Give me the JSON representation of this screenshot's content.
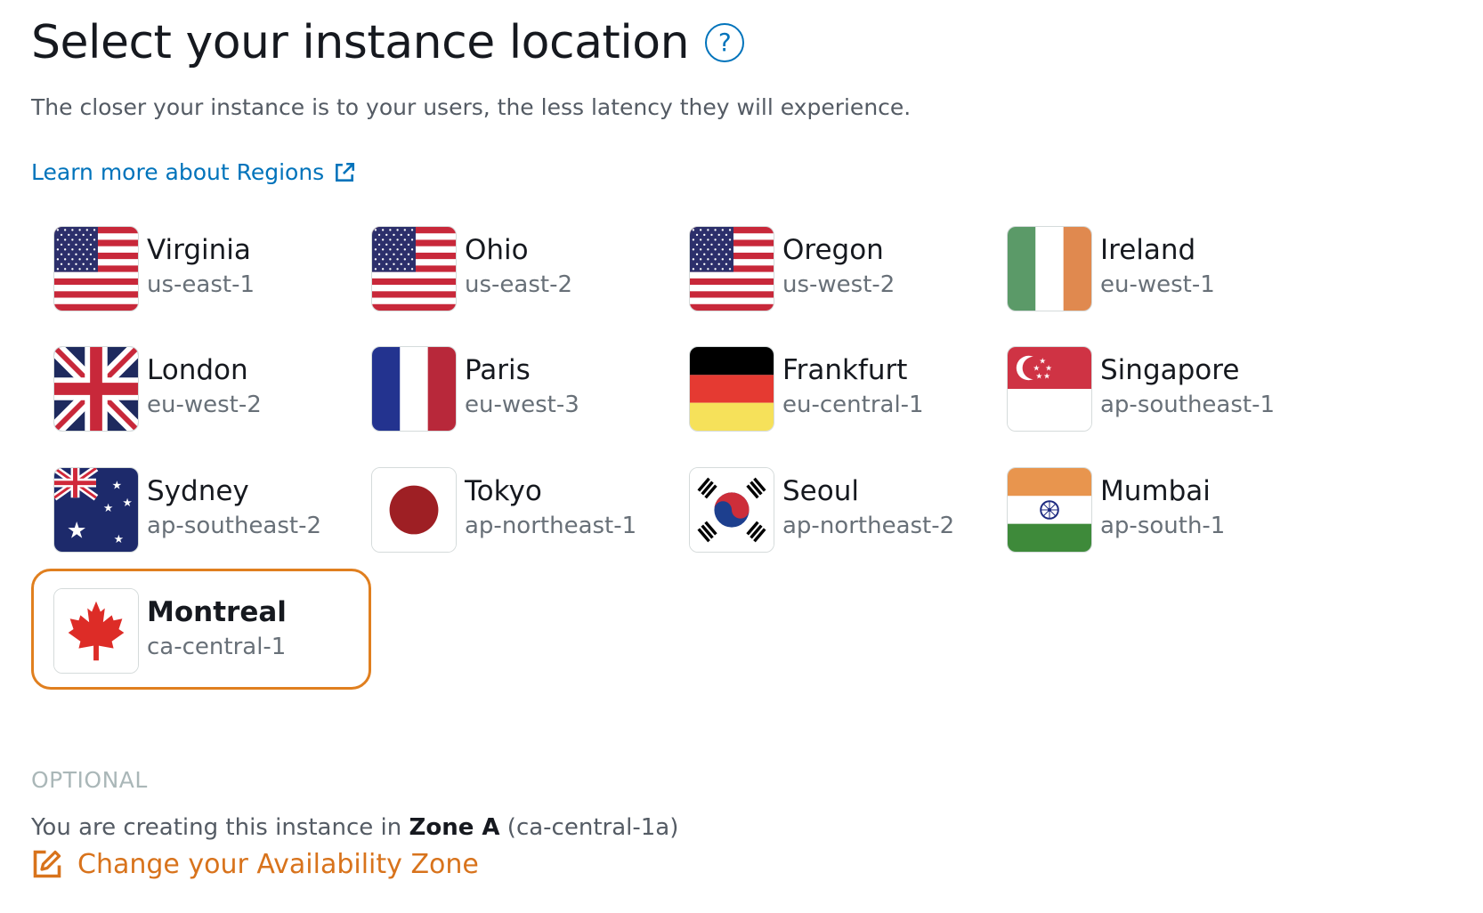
{
  "header": {
    "title": "Select your instance location",
    "help_icon": "question-circle-icon",
    "subtitle": "The closer your instance is to your users, the less latency they will experience.",
    "learn_more": "Learn more about Regions",
    "learn_more_icon": "external-link-icon"
  },
  "regions": [
    {
      "name": "Virginia",
      "code": "us-east-1",
      "flag": "us-flag-icon"
    },
    {
      "name": "Ohio",
      "code": "us-east-2",
      "flag": "us-flag-icon"
    },
    {
      "name": "Oregon",
      "code": "us-west-2",
      "flag": "us-flag-icon"
    },
    {
      "name": "Ireland",
      "code": "eu-west-1",
      "flag": "ireland-flag-icon"
    },
    {
      "name": "London",
      "code": "eu-west-2",
      "flag": "uk-flag-icon"
    },
    {
      "name": "Paris",
      "code": "eu-west-3",
      "flag": "france-flag-icon"
    },
    {
      "name": "Frankfurt",
      "code": "eu-central-1",
      "flag": "germany-flag-icon"
    },
    {
      "name": "Singapore",
      "code": "ap-southeast-1",
      "flag": "singapore-flag-icon"
    },
    {
      "name": "Sydney",
      "code": "ap-southeast-2",
      "flag": "australia-flag-icon"
    },
    {
      "name": "Tokyo",
      "code": "ap-northeast-1",
      "flag": "japan-flag-icon"
    },
    {
      "name": "Seoul",
      "code": "ap-northeast-2",
      "flag": "korea-flag-icon"
    },
    {
      "name": "Mumbai",
      "code": "ap-south-1",
      "flag": "india-flag-icon"
    },
    {
      "name": "Montreal",
      "code": "ca-central-1",
      "flag": "canada-flag-icon",
      "selected": true
    }
  ],
  "optional": {
    "label": "OPTIONAL",
    "zone_prefix": "You are creating this instance in ",
    "zone_name": "Zone A",
    "zone_suffix": " (ca-central-1a)",
    "change_link": "Change your Availability Zone",
    "change_icon": "edit-icon"
  },
  "colors": {
    "link": "#0073bb",
    "selected_border": "#e07f1f",
    "change_link": "#d8731c",
    "muted_text": "#687078"
  }
}
